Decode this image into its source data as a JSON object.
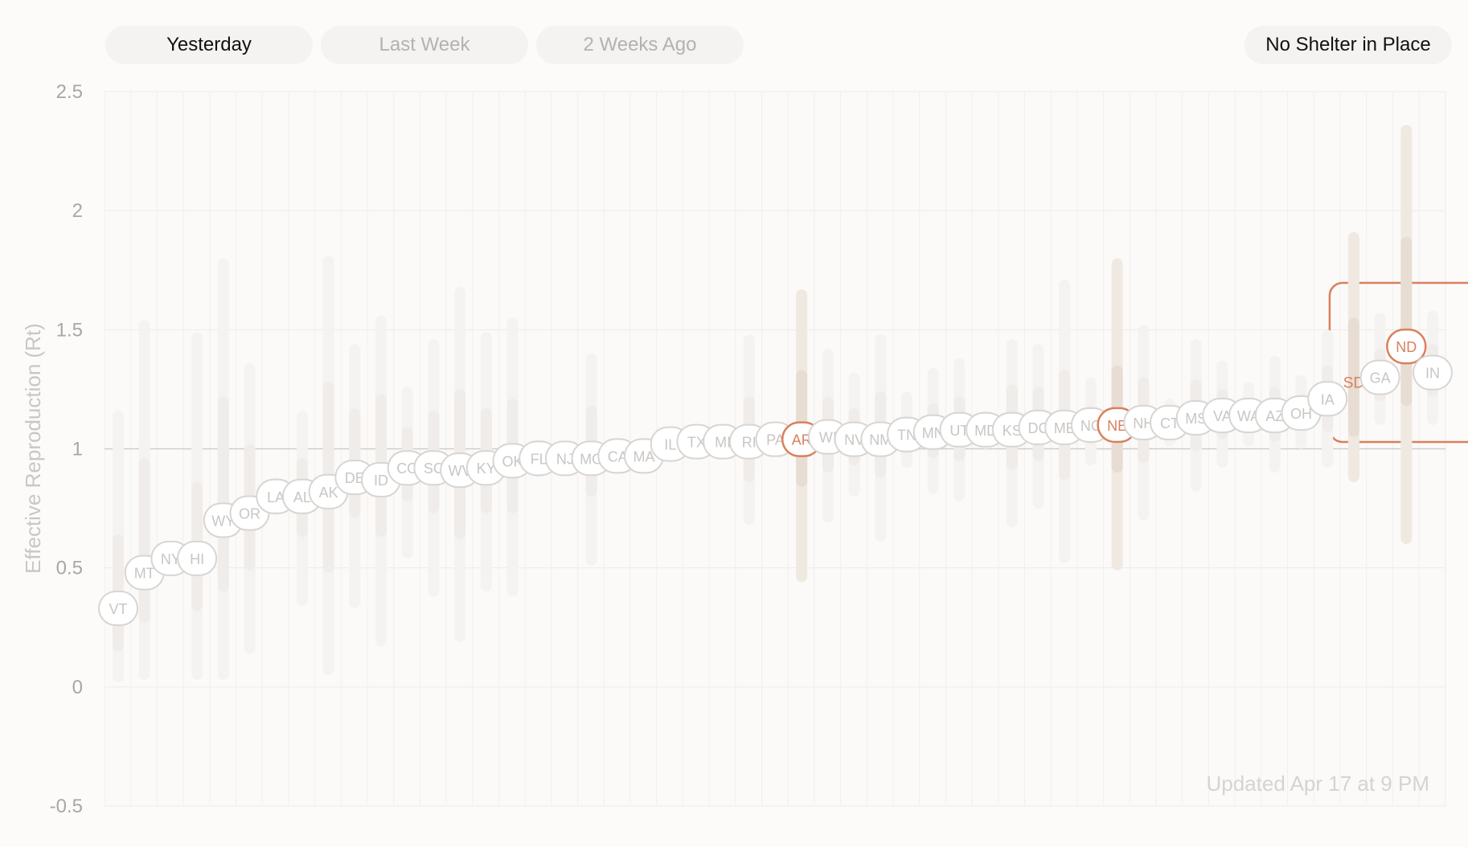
{
  "tabs": [
    {
      "label": "Yesterday",
      "active": true
    },
    {
      "label": "Last Week",
      "active": false
    },
    {
      "label": "2 Weeks Ago",
      "active": false
    }
  ],
  "filter_button": {
    "label": "No Shelter in Place"
  },
  "updated_text": "Updated Apr 17 at 9 PM",
  "colors": {
    "highlight": "#d9805c",
    "gridline": "#ecebea",
    "label_text": "#c9c6c3",
    "axis_text": "#a9a6a3",
    "reference_line": "#cfcdcb"
  },
  "chart_data": {
    "type": "scatter",
    "ylabel": "Effective Reproduction (Rt)",
    "ylim": [
      -0.5,
      2.5
    ],
    "yticks": [
      "2.5",
      "2",
      "1.5",
      "1",
      "0.5",
      "0",
      "-0.5"
    ],
    "yticks_values": [
      2.5,
      2,
      1.5,
      1,
      0.5,
      0,
      -0.5
    ],
    "reference_y": 1,
    "highlight_group": "No Shelter in Place",
    "points": [
      {
        "label": "VT",
        "y": 0.33,
        "lo80": 0.15,
        "hi80": 0.64,
        "lo90": 0.02,
        "hi90": 1.16,
        "highlight": false
      },
      {
        "label": "MT",
        "y": 0.48,
        "lo80": 0.27,
        "hi80": 0.96,
        "lo90": 0.03,
        "hi90": 1.54,
        "highlight": false
      },
      {
        "label": "NY",
        "y": 0.54,
        "lo80": 0.51,
        "hi80": 0.57,
        "lo90": 0.48,
        "hi90": 0.6,
        "highlight": false
      },
      {
        "label": "HI",
        "y": 0.54,
        "lo80": 0.32,
        "hi80": 0.86,
        "lo90": 0.03,
        "hi90": 1.49,
        "highlight": false
      },
      {
        "label": "WY",
        "y": 0.7,
        "lo80": 0.4,
        "hi80": 1.22,
        "lo90": 0.03,
        "hi90": 1.8,
        "highlight": false
      },
      {
        "label": "OR",
        "y": 0.73,
        "lo80": 0.49,
        "hi80": 1.02,
        "lo90": 0.14,
        "hi90": 1.36,
        "highlight": false
      },
      {
        "label": "LA",
        "y": 0.8,
        "lo80": 0.76,
        "hi80": 0.84,
        "lo90": 0.72,
        "hi90": 0.88,
        "highlight": false
      },
      {
        "label": "AL",
        "y": 0.8,
        "lo80": 0.63,
        "hi80": 0.96,
        "lo90": 0.34,
        "hi90": 1.16,
        "highlight": false
      },
      {
        "label": "AK",
        "y": 0.82,
        "lo80": 0.48,
        "hi80": 1.28,
        "lo90": 0.05,
        "hi90": 1.81,
        "highlight": false
      },
      {
        "label": "DE",
        "y": 0.88,
        "lo80": 0.71,
        "hi80": 1.17,
        "lo90": 0.33,
        "hi90": 1.44,
        "highlight": false
      },
      {
        "label": "ID",
        "y": 0.87,
        "lo80": 0.63,
        "hi80": 1.23,
        "lo90": 0.17,
        "hi90": 1.56,
        "highlight": false
      },
      {
        "label": "CO",
        "y": 0.92,
        "lo80": 0.78,
        "hi80": 1.09,
        "lo90": 0.54,
        "hi90": 1.26,
        "highlight": false
      },
      {
        "label": "SC",
        "y": 0.92,
        "lo80": 0.73,
        "hi80": 1.16,
        "lo90": 0.38,
        "hi90": 1.46,
        "highlight": false
      },
      {
        "label": "WV",
        "y": 0.91,
        "lo80": 0.62,
        "hi80": 1.25,
        "lo90": 0.19,
        "hi90": 1.68,
        "highlight": false
      },
      {
        "label": "KY",
        "y": 0.92,
        "lo80": 0.73,
        "hi80": 1.17,
        "lo90": 0.4,
        "hi90": 1.49,
        "highlight": false
      },
      {
        "label": "OK",
        "y": 0.95,
        "lo80": 0.73,
        "hi80": 1.21,
        "lo90": 0.38,
        "hi90": 1.55,
        "highlight": false
      },
      {
        "label": "FL",
        "y": 0.96,
        "lo80": 0.92,
        "hi80": 1.0,
        "lo90": 0.88,
        "hi90": 1.04,
        "highlight": false
      },
      {
        "label": "NJ",
        "y": 0.96,
        "lo80": 0.93,
        "hi80": 0.99,
        "lo90": 0.9,
        "hi90": 1.02,
        "highlight": false
      },
      {
        "label": "MO",
        "y": 0.96,
        "lo80": 0.8,
        "hi80": 1.18,
        "lo90": 0.51,
        "hi90": 1.4,
        "highlight": false
      },
      {
        "label": "CA",
        "y": 0.97,
        "lo80": 0.94,
        "hi80": 1.0,
        "lo90": 0.91,
        "hi90": 1.03,
        "highlight": false
      },
      {
        "label": "MA",
        "y": 0.97,
        "lo80": 0.94,
        "hi80": 1.0,
        "lo90": 0.91,
        "hi90": 1.03,
        "highlight": false
      },
      {
        "label": "IL",
        "y": 1.02,
        "lo80": 0.98,
        "hi80": 1.06,
        "lo90": 0.95,
        "hi90": 1.09,
        "highlight": false
      },
      {
        "label": "TX",
        "y": 1.03,
        "lo80": 0.99,
        "hi80": 1.07,
        "lo90": 0.96,
        "hi90": 1.1,
        "highlight": false
      },
      {
        "label": "MI",
        "y": 1.03,
        "lo80": 1.0,
        "hi80": 1.06,
        "lo90": 0.97,
        "hi90": 1.09,
        "highlight": false
      },
      {
        "label": "RI",
        "y": 1.03,
        "lo80": 0.86,
        "hi80": 1.22,
        "lo90": 0.68,
        "hi90": 1.48,
        "highlight": false
      },
      {
        "label": "PA",
        "y": 1.04,
        "lo80": 1.0,
        "hi80": 1.08,
        "lo90": 0.97,
        "hi90": 1.11,
        "highlight": false
      },
      {
        "label": "AR",
        "y": 1.04,
        "lo80": 0.84,
        "hi80": 1.33,
        "lo90": 0.44,
        "hi90": 1.67,
        "highlight": true
      },
      {
        "label": "WI",
        "y": 1.05,
        "lo80": 0.9,
        "hi80": 1.22,
        "lo90": 0.69,
        "hi90": 1.42,
        "highlight": false
      },
      {
        "label": "NV",
        "y": 1.04,
        "lo80": 0.93,
        "hi80": 1.17,
        "lo90": 0.8,
        "hi90": 1.32,
        "highlight": false
      },
      {
        "label": "NM",
        "y": 1.04,
        "lo80": 0.88,
        "hi80": 1.24,
        "lo90": 0.61,
        "hi90": 1.48,
        "highlight": false
      },
      {
        "label": "TN",
        "y": 1.06,
        "lo80": 0.98,
        "hi80": 1.14,
        "lo90": 0.92,
        "hi90": 1.24,
        "highlight": false
      },
      {
        "label": "MN",
        "y": 1.07,
        "lo80": 0.96,
        "hi80": 1.19,
        "lo90": 0.81,
        "hi90": 1.34,
        "highlight": false
      },
      {
        "label": "UT",
        "y": 1.08,
        "lo80": 0.95,
        "hi80": 1.22,
        "lo90": 0.78,
        "hi90": 1.38,
        "highlight": false
      },
      {
        "label": "MD",
        "y": 1.08,
        "lo80": 1.04,
        "hi80": 1.12,
        "lo90": 1.0,
        "hi90": 1.16,
        "highlight": false
      },
      {
        "label": "KS",
        "y": 1.08,
        "lo80": 0.91,
        "hi80": 1.27,
        "lo90": 0.67,
        "hi90": 1.46,
        "highlight": false
      },
      {
        "label": "DC",
        "y": 1.09,
        "lo80": 0.95,
        "hi80": 1.26,
        "lo90": 0.75,
        "hi90": 1.44,
        "highlight": false
      },
      {
        "label": "ME",
        "y": 1.09,
        "lo80": 0.87,
        "hi80": 1.33,
        "lo90": 0.52,
        "hi90": 1.71,
        "highlight": false
      },
      {
        "label": "NC",
        "y": 1.1,
        "lo80": 1.02,
        "hi80": 1.18,
        "lo90": 0.93,
        "hi90": 1.3,
        "highlight": false
      },
      {
        "label": "NE",
        "y": 1.1,
        "lo80": 0.9,
        "hi80": 1.35,
        "lo90": 0.49,
        "hi90": 1.8,
        "highlight": true
      },
      {
        "label": "NH",
        "y": 1.11,
        "lo80": 0.94,
        "hi80": 1.3,
        "lo90": 0.7,
        "hi90": 1.52,
        "highlight": false
      },
      {
        "label": "CT",
        "y": 1.11,
        "lo80": 1.06,
        "hi80": 1.16,
        "lo90": 1.01,
        "hi90": 1.21,
        "highlight": false
      },
      {
        "label": "MS",
        "y": 1.13,
        "lo80": 0.99,
        "hi80": 1.29,
        "lo90": 0.82,
        "hi90": 1.46,
        "highlight": false
      },
      {
        "label": "VA",
        "y": 1.14,
        "lo80": 1.04,
        "hi80": 1.25,
        "lo90": 0.92,
        "hi90": 1.37,
        "highlight": false
      },
      {
        "label": "WA",
        "y": 1.14,
        "lo80": 1.08,
        "hi80": 1.21,
        "lo90": 1.01,
        "hi90": 1.28,
        "highlight": false
      },
      {
        "label": "AZ",
        "y": 1.14,
        "lo80": 1.03,
        "hi80": 1.26,
        "lo90": 0.9,
        "hi90": 1.39,
        "highlight": false
      },
      {
        "label": "OH",
        "y": 1.15,
        "lo80": 1.08,
        "hi80": 1.23,
        "lo90": 1.0,
        "hi90": 1.31,
        "highlight": false
      },
      {
        "label": "IA",
        "y": 1.21,
        "lo80": 1.07,
        "hi80": 1.35,
        "lo90": 0.92,
        "hi90": 1.5,
        "highlight": false
      },
      {
        "label": "SD",
        "y": 1.28,
        "lo80": 1.05,
        "hi80": 1.55,
        "lo90": 0.86,
        "hi90": 1.91,
        "highlight": true
      },
      {
        "label": "GA",
        "y": 1.3,
        "lo80": 1.2,
        "hi80": 1.42,
        "lo90": 1.1,
        "hi90": 1.57,
        "highlight": false
      },
      {
        "label": "ND",
        "y": 1.43,
        "lo80": 1.18,
        "hi80": 1.89,
        "lo90": 0.6,
        "hi90": 2.36,
        "highlight": true
      },
      {
        "label": "IN",
        "y": 1.32,
        "lo80": 1.22,
        "hi80": 1.44,
        "lo90": 1.1,
        "hi90": 1.58,
        "highlight": false
      }
    ]
  }
}
